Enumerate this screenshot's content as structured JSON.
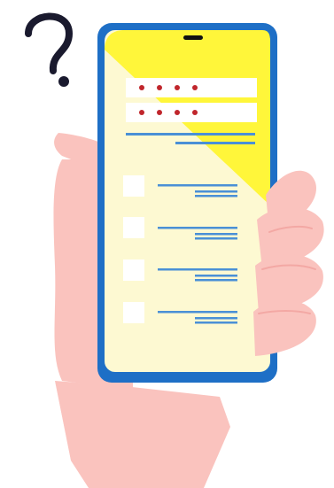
{
  "illustration": {
    "subject": "hand-holding-phone",
    "phone": {
      "password_fields": [
        {
          "masked_dots": 4
        },
        {
          "masked_dots": 4
        }
      ],
      "checklist_items": [
        {
          "checked": false
        },
        {
          "checked": false
        },
        {
          "checked": false
        },
        {
          "checked": false
        }
      ]
    },
    "icons": [
      "question-mark-icon",
      "notch-icon"
    ]
  },
  "colors": {
    "skin": "#FAC3BE",
    "skin_shade": "#F3A8A4",
    "outline": "#333333",
    "phone_frame": "#1E6FC6",
    "screen": "#FDF9D2",
    "screen_highlight": "#FFF63A",
    "field": "#FFFFFF",
    "dot": "#C0262C",
    "line": "#4A90D6",
    "checkbox": "#FFFFFF",
    "question_mark": "#1A1A2E"
  }
}
